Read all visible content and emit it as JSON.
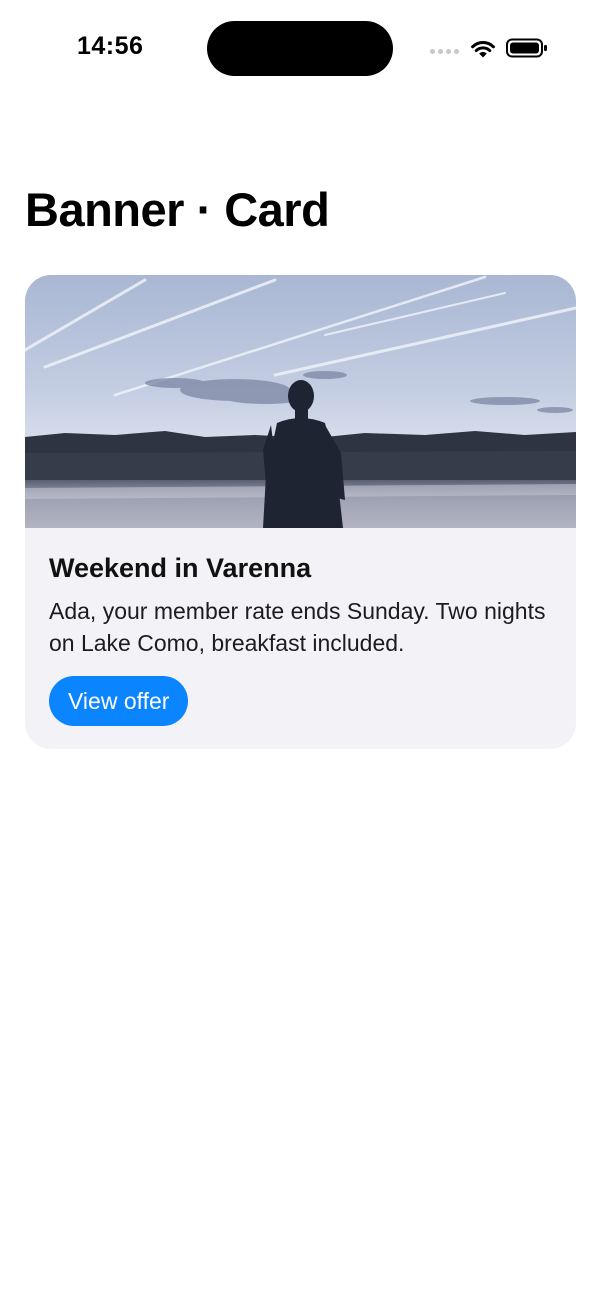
{
  "status_bar": {
    "time": "14:56",
    "icons": [
      "cellular-signal-icon",
      "wifi-icon",
      "battery-icon"
    ]
  },
  "page": {
    "title": "Banner · Card"
  },
  "card": {
    "image": "lake-silhouette-photo",
    "title": "Weekend in Varenna",
    "body": "Ada, your member rate ends Sunday. Two nights on Lake Como, breakfast included.",
    "button_label": "View offer"
  },
  "colors": {
    "accent": "#0a84ff",
    "card_background": "#f2f2f7",
    "page_background": "#ffffff"
  }
}
